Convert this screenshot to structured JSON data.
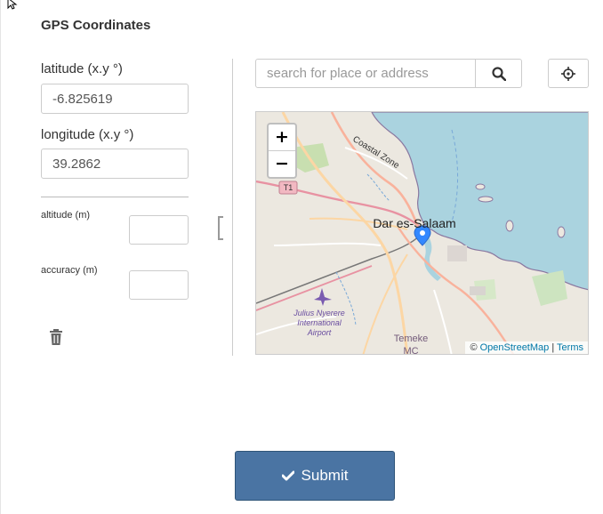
{
  "section": {
    "title": "GPS Coordinates"
  },
  "fields": {
    "latitude": {
      "label": "latitude (x.y °)",
      "value": "-6.825619"
    },
    "longitude": {
      "label": "longitude (x.y °)",
      "value": "39.2862"
    },
    "altitude": {
      "label": "altitude (m)",
      "value": ""
    },
    "accuracy": {
      "label": "accuracy (m)",
      "value": ""
    }
  },
  "search": {
    "placeholder": "search for place or address",
    "value": ""
  },
  "icons": {
    "search": "search-icon",
    "locate": "crosshair-icon",
    "delete": "trash-icon",
    "submit": "check-icon",
    "marker": "map-marker-icon",
    "airport": "airplane-icon"
  },
  "map": {
    "zoom_in": "+",
    "zoom_out": "−",
    "labels": {
      "city": "Dar es-Salaam",
      "coastal": "Coastal Zone",
      "road": "T1",
      "airport_1": "Julius Nyerere",
      "airport_2": "International",
      "airport_3": "Airport",
      "district_1": "Temeke",
      "district_2": "MC"
    },
    "attribution": {
      "prefix": "©",
      "osm": "OpenStreetMap",
      "sep": "|",
      "terms": "Terms"
    }
  },
  "submit": {
    "label": "Submit"
  },
  "colors": {
    "primary": "#4a74a3",
    "water": "#aad3df",
    "land": "#ece8e0",
    "marker": "#3388ff"
  }
}
